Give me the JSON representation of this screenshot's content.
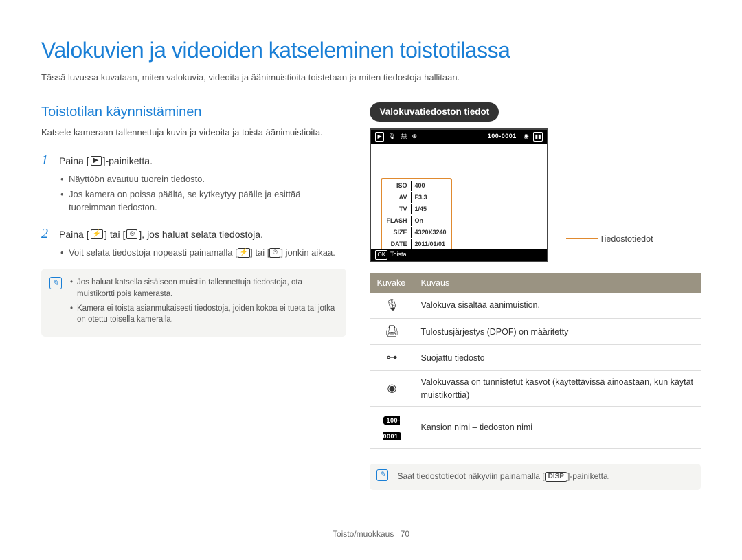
{
  "title": "Valokuvien ja videoiden katseleminen toistotilassa",
  "intro": "Tässä luvussa kuvataan, miten valokuvia, videoita ja äänimuistioita toistetaan ja miten tiedostoja hallitaan.",
  "section_heading": "Toistotilan käynnistäminen",
  "section_para": "Katsele kameraan tallennettuja kuvia ja videoita ja toista äänimuistioita.",
  "step1": {
    "num": "1",
    "pre": "Paina [",
    "icon_glyph": "▶",
    "post": "]-painiketta.",
    "bullets": [
      "Näyttöön avautuu tuorein tiedosto.",
      "Jos kamera on poissa päältä, se kytkeytyy päälle ja esittää tuoreimman tiedoston."
    ]
  },
  "step2": {
    "num": "2",
    "pre": "Paina [",
    "icon1": "⚡",
    "mid": "] tai [",
    "icon2": "⏲",
    "post": "], jos haluat selata tiedostoja.",
    "bullet_pre": "Voit selata tiedostoja nopeasti painamalla [",
    "bullet_mid": "] tai [",
    "bullet_post": "] jonkin aikaa."
  },
  "note1": {
    "items": [
      "Jos haluat katsella sisäiseen muistiin tallennettuja tiedostoja, ota muistikortti pois kamerasta.",
      "Kamera ei toista asianmukaisesti tiedostoja, joiden kokoa ei tueta tai jotka on otettu toisella kameralla."
    ]
  },
  "right": {
    "pill": "Valokuvatiedoston tiedot",
    "lcd": {
      "top_counter": "100-0001",
      "info_rows": [
        [
          "ISO",
          "400"
        ],
        [
          "AV",
          "F3.3"
        ],
        [
          "TV",
          "1/45"
        ],
        [
          "FLASH",
          "On"
        ],
        [
          "SIZE",
          "4320X3240"
        ],
        [
          "DATE",
          "2011/01/01"
        ]
      ],
      "bottom_ok": "OK",
      "bottom_label": "Toista"
    },
    "leader": "Tiedostotiedot",
    "table": {
      "h1": "Kuvake",
      "h2": "Kuvaus",
      "rows": [
        {
          "icon": "mic",
          "desc": "Valokuva sisältää äänimuistion."
        },
        {
          "icon": "print",
          "desc": "Tulostusjärjestys (DPOF) on määritetty"
        },
        {
          "icon": "lock",
          "desc": "Suojattu tiedosto"
        },
        {
          "icon": "face",
          "desc": "Valokuvassa on tunnistetut kasvot (käytettävissä ainoastaan, kun käytät muistikorttia)"
        },
        {
          "icon": "folder",
          "desc": "Kansion nimi – tiedoston nimi"
        }
      ],
      "folder_label": "100-0001"
    },
    "note2_pre": "Saat tiedostotiedot näkyviin painamalla [",
    "note2_btn": "DISP",
    "note2_post": "]-painiketta."
  },
  "footer": {
    "section": "Toisto/muokkaus",
    "page": "70"
  }
}
